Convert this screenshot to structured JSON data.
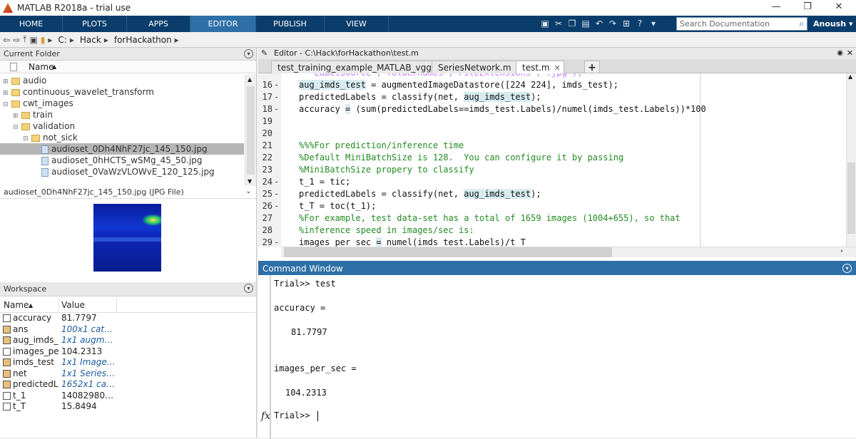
{
  "window": {
    "title": "MATLAB R2018a - trial use"
  },
  "ribbon": {
    "tabs": [
      "HOME",
      "PLOTS",
      "APPS",
      "EDITOR",
      "PUBLISH",
      "VIEW"
    ],
    "active_tab": "EDITOR",
    "search_placeholder": "Search Documentation",
    "user": "Anoush"
  },
  "address": {
    "path": [
      "C:",
      "Hack",
      "forHackathon"
    ]
  },
  "current_folder": {
    "title": "Current Folder",
    "column": "Name",
    "items": [
      {
        "label": "audio",
        "level": 0,
        "type": "folder",
        "expand": "+"
      },
      {
        "label": "continuous_wavelet_transform",
        "level": 0,
        "type": "folder",
        "expand": "+"
      },
      {
        "label": "cwt_images",
        "level": 0,
        "type": "folder",
        "expand": "-"
      },
      {
        "label": "train",
        "level": 1,
        "type": "folder",
        "expand": "+"
      },
      {
        "label": "validation",
        "level": 1,
        "type": "folder",
        "expand": "-"
      },
      {
        "label": "not_sick",
        "level": 2,
        "type": "folder",
        "expand": "-"
      },
      {
        "label": "audioset_0Dh4NhF27jc_145_150.jpg",
        "level": 3,
        "type": "image",
        "expand": "",
        "selected": true
      },
      {
        "label": "audioset_0hHCTS_wSMg_45_50.jpg",
        "level": 3,
        "type": "image",
        "expand": ""
      },
      {
        "label": "audioset_0VaWzVLOWvE_120_125.jpg",
        "level": 3,
        "type": "image",
        "expand": ""
      }
    ]
  },
  "details": {
    "title": "audioset_0Dh4NhF27jc_145_150.jpg  (JPG File)"
  },
  "workspace": {
    "title": "Workspace",
    "columns": [
      "Name",
      "Value"
    ],
    "rows": [
      {
        "name": "accuracy",
        "value": "81.7797",
        "italic": false,
        "obj": false
      },
      {
        "name": "ans",
        "value": "100x1 catego...",
        "italic": true,
        "obj": true
      },
      {
        "name": "aug_imds_...",
        "value": "1x1 augment...",
        "italic": true,
        "obj": true
      },
      {
        "name": "images_pe...",
        "value": "104.2313",
        "italic": false,
        "obj": false
      },
      {
        "name": "imds_test",
        "value": "1x1 ImageDa...",
        "italic": true,
        "obj": true
      },
      {
        "name": "net",
        "value": "1x1 SeriesNet...",
        "italic": true,
        "obj": true
      },
      {
        "name": "predictedL...",
        "value": "1652x1 categ...",
        "italic": true,
        "obj": true
      },
      {
        "name": "t_1",
        "value": "14082980470",
        "italic": false,
        "obj": false
      },
      {
        "name": "t_T",
        "value": "15.8494",
        "italic": false,
        "obj": false
      }
    ]
  },
  "editor": {
    "title": "Editor - C:\\Hack\\forHackathon\\test.m",
    "tabs": [
      "test_training_example_MATLAB_vgg.m",
      "SeriesNetwork.m",
      "test.m"
    ],
    "active_tab": "test.m",
    "lines": [
      {
        "n": "16",
        "dash": "-",
        "code": "aug_imds_test = augmentedImageDatastore([224 224], imds_test);"
      },
      {
        "n": "17",
        "dash": "-",
        "code": "predictedLabels = classify(net, aug_imds_test);"
      },
      {
        "n": "18",
        "dash": "-",
        "code": "accuracy = (sum(predictedLabels==imds_test.Labels)/numel(imds_test.Labels))*100"
      },
      {
        "n": "19",
        "dash": "",
        "code": ""
      },
      {
        "n": "20",
        "dash": "",
        "code": ""
      },
      {
        "n": "21",
        "dash": "",
        "code": "%%%For prediction/inference time"
      },
      {
        "n": "22",
        "dash": "",
        "code": "%Default MiniBatchSize is 128.  You can configure it by passing"
      },
      {
        "n": "23",
        "dash": "",
        "code": "%MiniBatchSize propery to classify"
      },
      {
        "n": "24",
        "dash": "-",
        "code": "t_1 = tic;"
      },
      {
        "n": "25",
        "dash": "-",
        "code": "predictedLabels = classify(net, aug_imds_test);"
      },
      {
        "n": "26",
        "dash": "-",
        "code": "t_T = toc(t_1);"
      },
      {
        "n": "27",
        "dash": "",
        "code": "%For example, test data-set has a total of 1659 images (1004+655), so that"
      },
      {
        "n": "28",
        "dash": "",
        "code": "%inference speed in images/sec is:"
      },
      {
        "n": "29",
        "dash": "-",
        "code": "images_per_sec = numel(imds_test.Labels)/t_T"
      }
    ]
  },
  "command_window": {
    "title": "Command Window",
    "lines": [
      "Trial>> test",
      "accuracy =",
      "81.7797",
      "images_per_sec =",
      "104.2313",
      "Trial>> "
    ],
    "fx": "fx"
  }
}
